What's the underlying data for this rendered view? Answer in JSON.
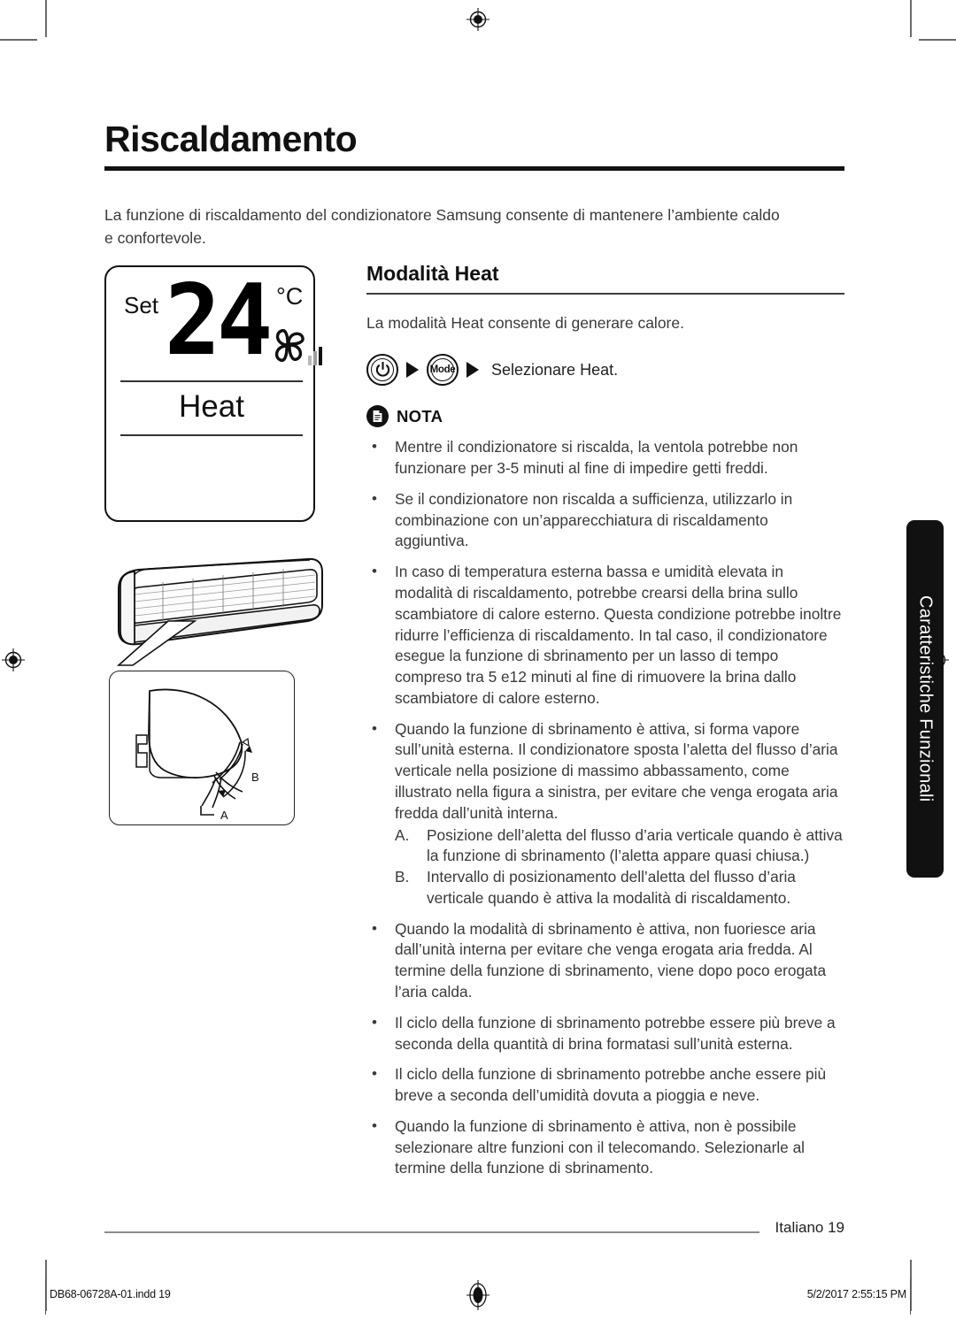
{
  "document": {
    "title": "Riscaldamento",
    "intro": "La funzione di riscaldamento del condizionatore Samsung consente di mantenere l’ambiente caldo e confortevole."
  },
  "lcd": {
    "set_label": "Set",
    "temperature": "24",
    "unit": "°C",
    "mode": "Heat",
    "fan_icon": "fan-icon",
    "fan_level_bars": 3
  },
  "diagram": {
    "unit_name": "indoor-unit-illustration",
    "label_a": "A",
    "label_b": "B"
  },
  "section": {
    "heading": "Modalità Heat",
    "lead": "La modalità Heat consente di generare calore.",
    "sequence": {
      "power_icon": "power-icon",
      "mode_label": "Mode",
      "instruction": "Selezionare Heat."
    },
    "note_label": "NOTA",
    "note_icon": "document-note-icon",
    "notes": [
      "Mentre il condizionatore si riscalda, la ventola potrebbe non funzionare per 3-5 minuti al fine di impedire getti freddi.",
      "Se il condizionatore non riscalda a sufficienza, utilizzarlo in combinazione con un’apparecchiatura di riscaldamento aggiuntiva.",
      "In caso di temperatura esterna bassa e umidità elevata in modalità di riscaldamento, potrebbe crearsi della brina sullo scambiatore di calore esterno. Questa condizione potrebbe inoltre ridurre l’efficienza di riscaldamento. In tal caso, il condizionatore esegue la funzione di sbrinamento per un lasso di tempo compreso tra 5 e12 minuti al fine di rimuovere la brina dallo scambiatore di calore esterno.",
      "Quando la funzione di sbrinamento è attiva, si forma vapore sull’unità esterna. Il condizionatore sposta l’aletta del flusso d’aria verticale nella posizione di massimo abbassamento, come illustrato nella figura a sinistra, per evitare che venga erogata aria fredda dall’unità interna.",
      "Quando la modalità di sbrinamento è attiva, non fuoriesce aria dall’unità interna per evitare che venga erogata aria fredda. Al termine della funzione di sbrinamento, viene dopo poco erogata l’aria calda.",
      "Il ciclo della funzione di sbrinamento potrebbe essere più breve a seconda della quantità di brina formatasi sull’unità esterna.",
      "Il ciclo della funzione di sbrinamento potrebbe anche essere più breve a seconda dell’umidità dovuta a pioggia e neve.",
      "Quando la funzione di sbrinamento è attiva, non è possibile selezionare altre funzioni con il telecomando. Selezionarle al termine della funzione di sbrinamento."
    ],
    "sub_items": [
      {
        "marker": "A.",
        "text": "Posizione dell’aletta del flusso d’aria verticale quando è attiva la funzione di sbrinamento (l’aletta appare quasi chiusa.)"
      },
      {
        "marker": "B.",
        "text": "Intervallo di posizionamento dell’aletta del flusso d’aria verticale quando è attiva la modalità di riscaldamento."
      }
    ]
  },
  "side_tab": {
    "label": "Caratteristiche Funzionali"
  },
  "footer": {
    "page_label": "Italiano  19"
  },
  "print_bar": {
    "file": "DB68-06728A-01.indd   19",
    "timestamp": "5/2/2017   2:55:15 PM"
  },
  "colors": {
    "ink": "#111111",
    "body_text": "#3a3a3a",
    "rule": "#8c8c8c",
    "tab_bg": "#111111"
  }
}
